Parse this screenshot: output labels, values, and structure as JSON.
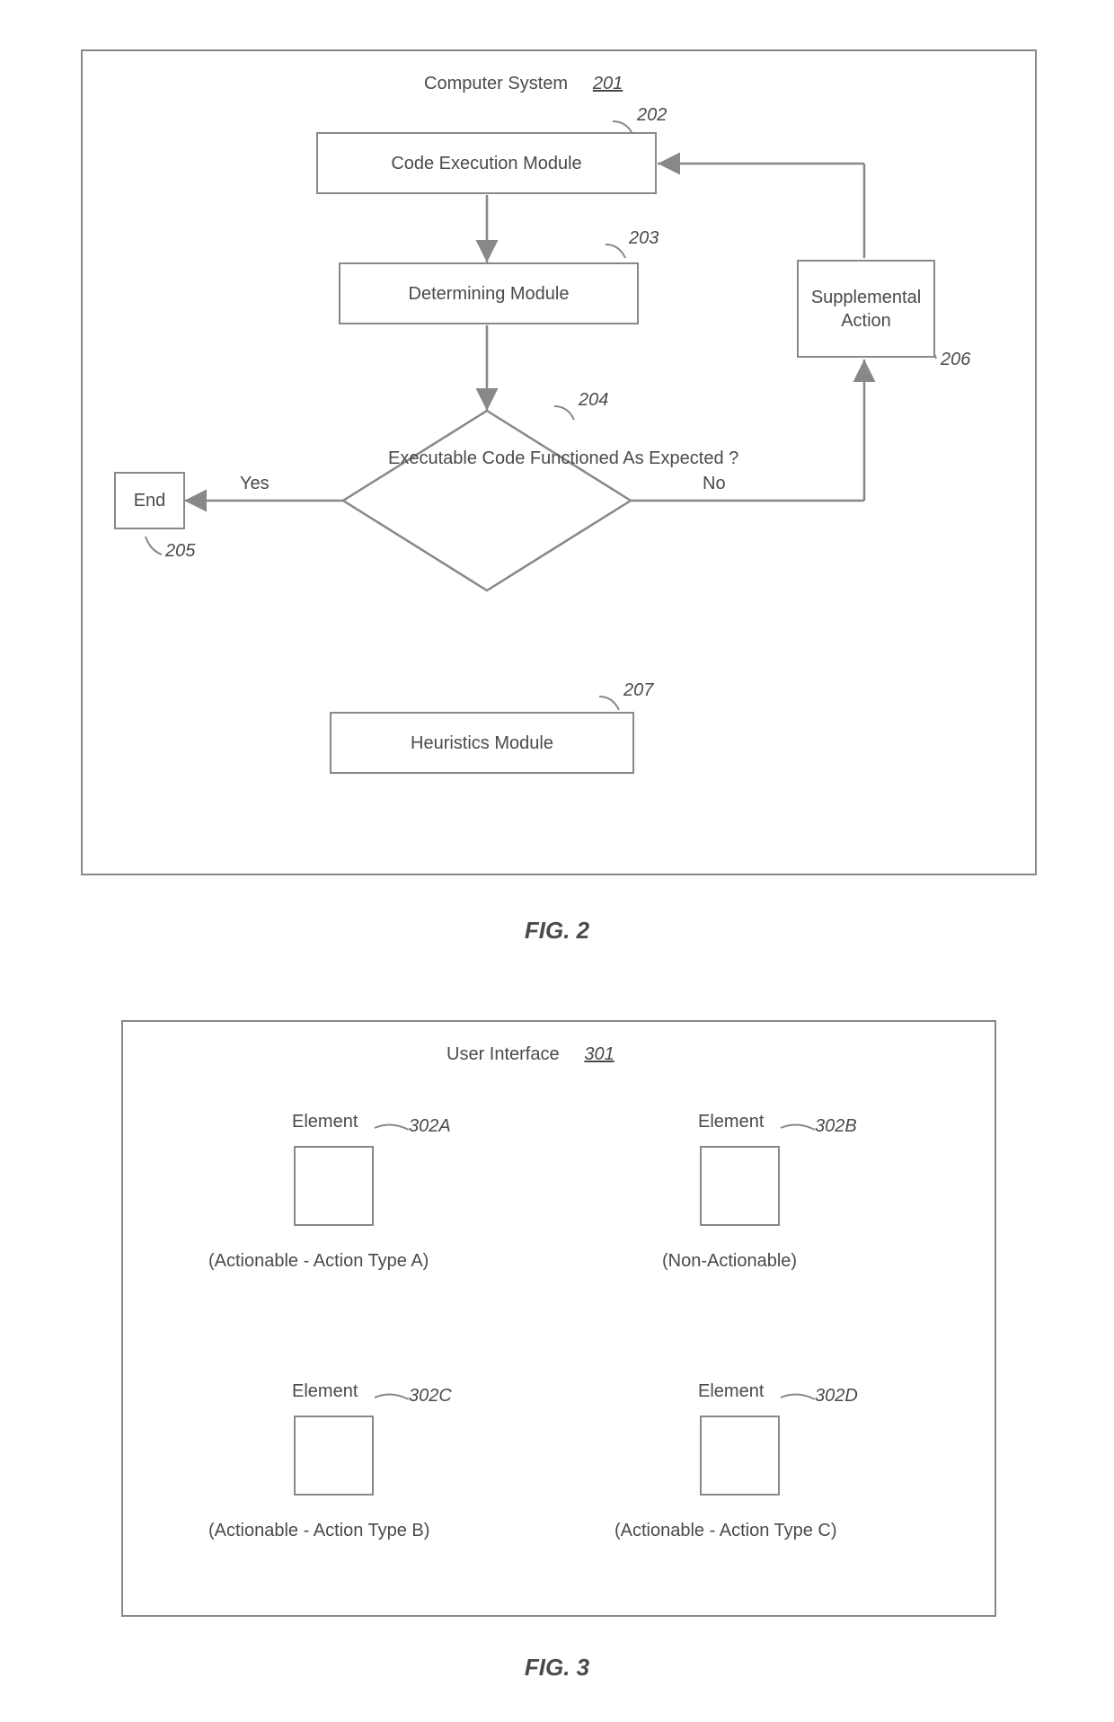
{
  "fig2": {
    "caption": "FIG. 2",
    "title": "Computer System",
    "title_ref": "201",
    "nodes": {
      "code_exec": {
        "label": "Code Execution Module",
        "ref": "202"
      },
      "determining": {
        "label": "Determining Module",
        "ref": "203"
      },
      "decision": {
        "label": "Executable Code Functioned As Expected ?",
        "ref": "204"
      },
      "end": {
        "label": "End",
        "ref": "205"
      },
      "supplemental": {
        "label": "Supplemental Action",
        "ref": "206"
      },
      "heuristics": {
        "label": "Heuristics Module",
        "ref": "207"
      }
    },
    "edges": {
      "yes": "Yes",
      "no": "No"
    }
  },
  "fig3": {
    "caption": "FIG. 3",
    "title": "User Interface",
    "title_ref": "301",
    "elements": {
      "a": {
        "label": "Element",
        "ref": "302A",
        "cap": "(Actionable - Action Type A)"
      },
      "b": {
        "label": "Element",
        "ref": "302B",
        "cap": "(Non-Actionable)"
      },
      "c": {
        "label": "Element",
        "ref": "302C",
        "cap": "(Actionable - Action Type B)"
      },
      "d": {
        "label": "Element",
        "ref": "302D",
        "cap": "(Actionable - Action Type C)"
      }
    }
  }
}
